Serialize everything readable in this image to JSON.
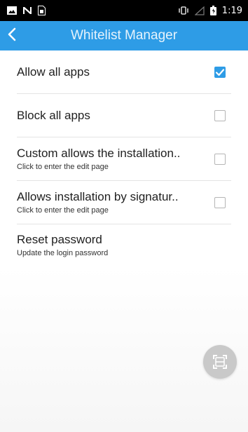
{
  "status_bar": {
    "time": "1:19",
    "left_icons": [
      "image-notification-icon",
      "n-notification-icon",
      "sim-icon"
    ],
    "right_icons": [
      "vibrate-icon",
      "signal-icon",
      "battery-icon"
    ]
  },
  "app_bar": {
    "title": "Whitelist Manager",
    "back_icon": "chevron-left-icon",
    "color": "#2e9ce6"
  },
  "settings": [
    {
      "title": "Allow all apps",
      "subtitle": "",
      "checked": true
    },
    {
      "title": "Block all apps",
      "subtitle": "",
      "checked": false
    },
    {
      "title": "Custom allows the installation..",
      "subtitle": "Click to enter the edit page",
      "checked": false
    },
    {
      "title": "Allows installation by signatur..",
      "subtitle": "Click to enter the edit page",
      "checked": false
    },
    {
      "title": "Reset password",
      "subtitle": "Update the login password"
    }
  ],
  "fab": {
    "icon": "scan-frame-icon"
  }
}
